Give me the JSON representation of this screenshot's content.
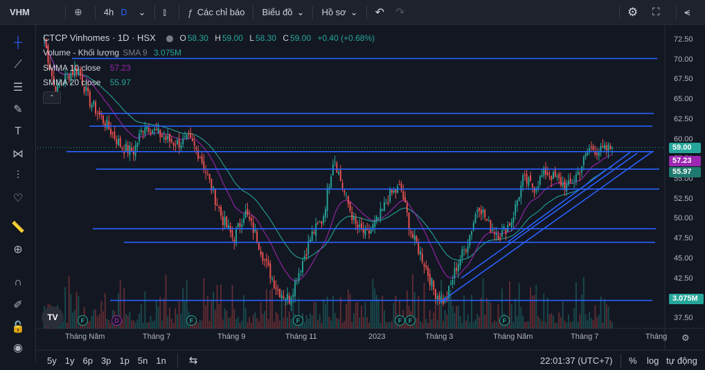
{
  "toolbar": {
    "symbol": "VHM",
    "add_icon": "plus-circle-icon",
    "interval": "4h",
    "interval_alt": "D",
    "chart_type_icon": "candles-icon",
    "indicators_label": "Các chỉ báo",
    "layout_label": "Biểu đồ",
    "profile_label": "Hồ sơ",
    "undo_icon": "undo-icon",
    "redo_icon": "redo-icon",
    "settings_icon": "gear-icon",
    "fullscreen_icon": "fullscreen-icon",
    "share_icon": "share-icon"
  },
  "left_tools": [
    "crosshair-icon",
    "trendline-icon",
    "fib-icon",
    "brush-icon",
    "text-icon",
    "pattern-icon",
    "measure-lines-icon",
    "heart-icon",
    "ruler-icon",
    "zoom-icon",
    "magnet-icon",
    "lock-draw-icon",
    "lock-icon",
    "eye-icon"
  ],
  "legend": {
    "title": "CTCP Vinhomes · 1D · HSX",
    "ohlc": {
      "o_label": "O",
      "o": "58.30",
      "h_label": "H",
      "h": "59.00",
      "l_label": "L",
      "l": "58.30",
      "c_label": "C",
      "c": "59.00",
      "change": "+0.40 (+0.68%)"
    },
    "volume": {
      "label": "Volume - Khối lượng",
      "ma_label": "SMA 9",
      "value": "3.075M"
    },
    "smma10": {
      "label": "SMMA 10 close",
      "value": "57.23"
    },
    "smma20": {
      "label": "SMMA 20 close",
      "value": "55.97"
    }
  },
  "price_axis": [
    "72.50",
    "70.00",
    "67.50",
    "65.00",
    "62.50",
    "60.00",
    "57.50",
    "55.00",
    "52.50",
    "50.00",
    "47.50",
    "45.00",
    "42.50",
    "40.00",
    "37.50"
  ],
  "badges": {
    "last_price": "59.00",
    "smma10": "57.23",
    "smma20": "55.97",
    "volume": "3.075M"
  },
  "time_axis": [
    "Tháng Năm",
    "Tháng 7",
    "Tháng 9",
    "Tháng 11",
    "2023",
    "Tháng 3",
    "Tháng Năm",
    "Tháng 7",
    "Tháng"
  ],
  "markers": [
    "F",
    "D",
    "F",
    "F",
    "F",
    "F",
    "F"
  ],
  "bottom": {
    "ranges": [
      "5y",
      "1y",
      "6p",
      "3p",
      "1p",
      "5n",
      "1n"
    ],
    "goto_icon": "calendar-goto-icon",
    "clock": "22:01:37 (UTC+7)",
    "percent": "%",
    "log": "log",
    "auto": "tự động"
  },
  "colors": {
    "up": "#26a69a",
    "down": "#ef5350",
    "hline": "#2962ff",
    "smma10": "#9c27b0",
    "smma20": "#26a69a"
  },
  "chart_data": {
    "type": "candlestick",
    "title": "CTCP Vinhomes · 1D · HSX",
    "ylim": [
      36.5,
      73.5
    ],
    "ticks_y": [
      72.5,
      70,
      67.5,
      65,
      62.5,
      60,
      57.5,
      55,
      52.5,
      50,
      47.5,
      45,
      42.5,
      40,
      37.5
    ],
    "x_labels": [
      "Tháng Năm",
      "Tháng 7",
      "Tháng 9",
      "Tháng 11",
      "2023",
      "Tháng 3",
      "Tháng Năm",
      "Tháng 7",
      "Tháng"
    ],
    "anchor_closes": [
      72.5,
      66,
      68,
      69,
      65,
      63,
      61,
      59,
      58.5,
      62,
      61,
      60,
      59.5,
      60,
      58,
      54,
      50,
      47.5,
      51,
      48,
      44,
      41,
      40,
      44,
      48,
      50,
      58,
      53,
      49,
      48,
      50,
      53,
      54,
      48,
      45,
      41,
      39.5,
      44,
      47,
      52,
      49,
      48,
      50,
      55,
      54,
      56,
      55,
      54,
      56,
      59,
      58.5,
      59
    ],
    "horizontal_levels": [
      70.2,
      63.3,
      61.7,
      58.5,
      56.3,
      53.8,
      48.8,
      47.1,
      39.8
    ],
    "last": {
      "open": 58.3,
      "high": 59.0,
      "low": 58.3,
      "close": 59.0,
      "change": 0.4,
      "change_pct": 0.68
    },
    "volume_ma9": 3.075,
    "smma10_last": 57.23,
    "smma20_last": 55.97
  }
}
